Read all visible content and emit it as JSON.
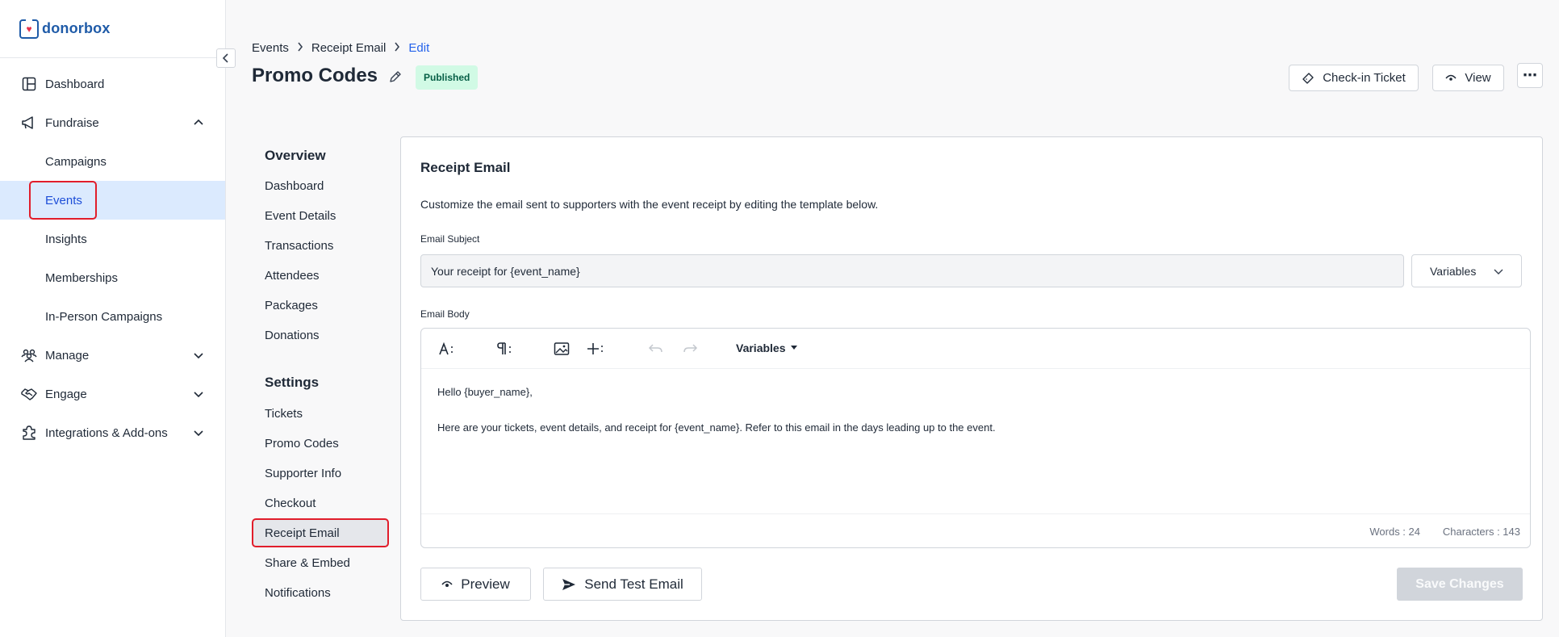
{
  "brand": {
    "name": "donorbox",
    "color": "#1f5ba8",
    "heart_color": "#e8324a"
  },
  "sidebar": {
    "items": [
      {
        "label": "Dashboard",
        "icon": "dashboard-icon"
      },
      {
        "label": "Fundraise",
        "icon": "megaphone-icon",
        "expanded": true,
        "children": [
          "Campaigns",
          "Events",
          "Insights",
          "Memberships",
          "In-Person Campaigns"
        ],
        "active_child": "Events"
      },
      {
        "label": "Manage",
        "icon": "people-icon",
        "expanded": false
      },
      {
        "label": "Engage",
        "icon": "handshake-icon",
        "expanded": false
      },
      {
        "label": "Integrations & Add-ons",
        "icon": "puzzle-icon",
        "expanded": false
      }
    ]
  },
  "breadcrumb": {
    "items": [
      "Events",
      "Receipt Email"
    ],
    "current": "Edit"
  },
  "header": {
    "title": "Promo Codes",
    "status": "Published",
    "checkin_label": "Check-in Ticket",
    "view_label": "View",
    "more_label": "⋯"
  },
  "subnav": {
    "overview_heading": "Overview",
    "overview_links": [
      "Dashboard",
      "Event Details",
      "Transactions",
      "Attendees",
      "Packages",
      "Donations"
    ],
    "settings_heading": "Settings",
    "settings_links": [
      "Tickets",
      "Promo Codes",
      "Supporter Info",
      "Checkout",
      "Receipt Email",
      "Share & Embed",
      "Notifications"
    ],
    "active": "Receipt Email"
  },
  "card": {
    "title": "Receipt Email",
    "description": "Customize the email sent to supporters with the event receipt by editing the template below.",
    "subject_label": "Email Subject",
    "subject_value": "Your receipt for {event_name}",
    "variables_label": "Variables",
    "body_label": "Email Body",
    "toolbar": {
      "variables_label": "Variables"
    },
    "body_lines": [
      "Hello {buyer_name},",
      "Here are your tickets, event details, and receipt for {event_name}. Refer to this email in the days leading up to the event."
    ],
    "words": "Words : 24",
    "characters": "Characters : 143",
    "preview_label": "Preview",
    "send_test_label": "Send Test Email",
    "save_label": "Save Changes"
  }
}
